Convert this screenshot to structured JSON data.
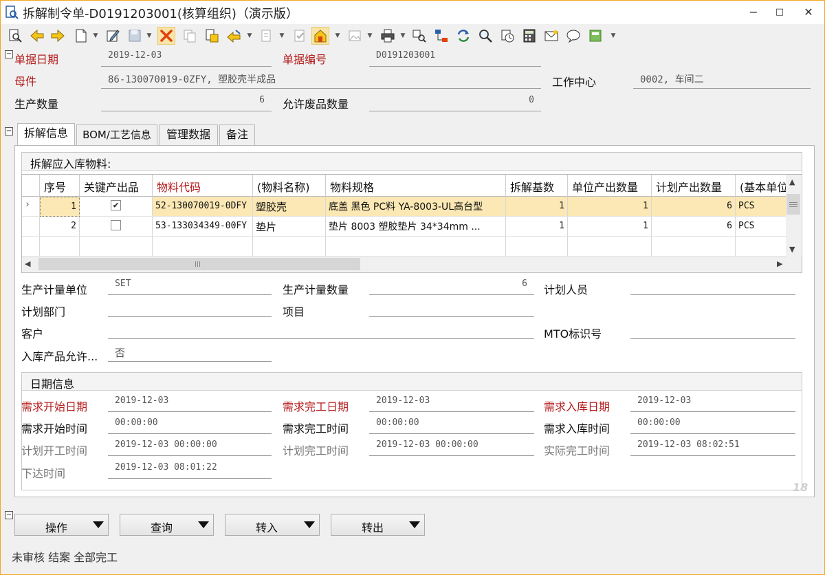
{
  "window": {
    "title": "拆解制令单-D0191203001(核算组织)（演示版）",
    "min_label": "−",
    "max_label": "□",
    "close_label": "✕"
  },
  "header": {
    "date_label": "单据日期",
    "date_value": "2019-12-03",
    "billno_label": "单据编号",
    "billno_value": "D0191203001",
    "parent_label": "母件",
    "parent_value": "86-130070019-0ZFY, 塑胶壳半成品",
    "workcenter_label": "工作中心",
    "workcenter_value": "0002, 车间二",
    "qty_label": "生产数量",
    "qty_value": "6",
    "scrap_label": "允许废品数量",
    "scrap_value": "0"
  },
  "tabs": [
    "拆解信息",
    "BOM/工艺信息",
    "管理数据",
    "备注"
  ],
  "materials": {
    "title": "拆解应入库物料:",
    "columns": [
      "序号",
      "关键产出品",
      "物料代码",
      "(物料名称)",
      "物料规格",
      "拆解基数",
      "单位产出数量",
      "计划产出数量",
      "(基本单位"
    ],
    "rows": [
      {
        "seq": "1",
        "key": true,
        "code": "52-130070019-0DFY",
        "name": "塑胶壳",
        "spec": "底盖 黑色 PC料 YA-8003-UL高台型",
        "base": "1",
        "unit_qty": "1",
        "plan_qty": "6",
        "uom": "PCS"
      },
      {
        "seq": "2",
        "key": false,
        "code": "53-133034349-00FY",
        "name": "垫片",
        "spec": "垫片 8003 塑胶垫片 34*34mm  ...",
        "base": "1",
        "unit_qty": "1",
        "plan_qty": "6",
        "uom": "PCS"
      }
    ]
  },
  "production": {
    "unit_label": "生产计量单位",
    "unit_value": "SET",
    "pqty_label": "生产计量数量",
    "pqty_value": "6",
    "planner_label": "计划人员",
    "planner_value": "",
    "dept_label": "计划部门",
    "dept_value": "",
    "project_label": "项目",
    "project_value": "",
    "customer_label": "客户",
    "customer_value": "",
    "mto_label": "MTO标识号",
    "mto_value": "",
    "allow_label": "入库产品允许...",
    "allow_value": "否"
  },
  "dates": {
    "title": "日期信息",
    "req_start_date_label": "需求开始日期",
    "req_start_date": "2019-12-03",
    "req_end_date_label": "需求完工日期",
    "req_end_date": "2019-12-03",
    "req_in_date_label": "需求入库日期",
    "req_in_date": "2019-12-03",
    "req_start_time_label": "需求开始时间",
    "req_start_time": "00:00:00",
    "req_end_time_label": "需求完工时间",
    "req_end_time": "00:00:00",
    "req_in_time_label": "需求入库时间",
    "req_in_time": "00:00:00",
    "plan_start_label": "计划开工时间",
    "plan_start": "2019-12-03 00:00:00",
    "plan_end_label": "计划完工时间",
    "plan_end": "2019-12-03 00:00:00",
    "actual_end_label": "实际完工时间",
    "actual_end": "2019-12-03 08:02:51",
    "release_label": "下达时间",
    "release": "2019-12-03 08:01:22"
  },
  "buttons": {
    "operate": "操作",
    "query": "查询",
    "transfer_in": "转入",
    "transfer_out": "转出"
  },
  "watermark": "18",
  "status": "未审核 结案 全部完工",
  "colors": {
    "required_label": "#b31a1a",
    "selected_row": "#fbe8b4",
    "window_border": "#f5a623"
  }
}
